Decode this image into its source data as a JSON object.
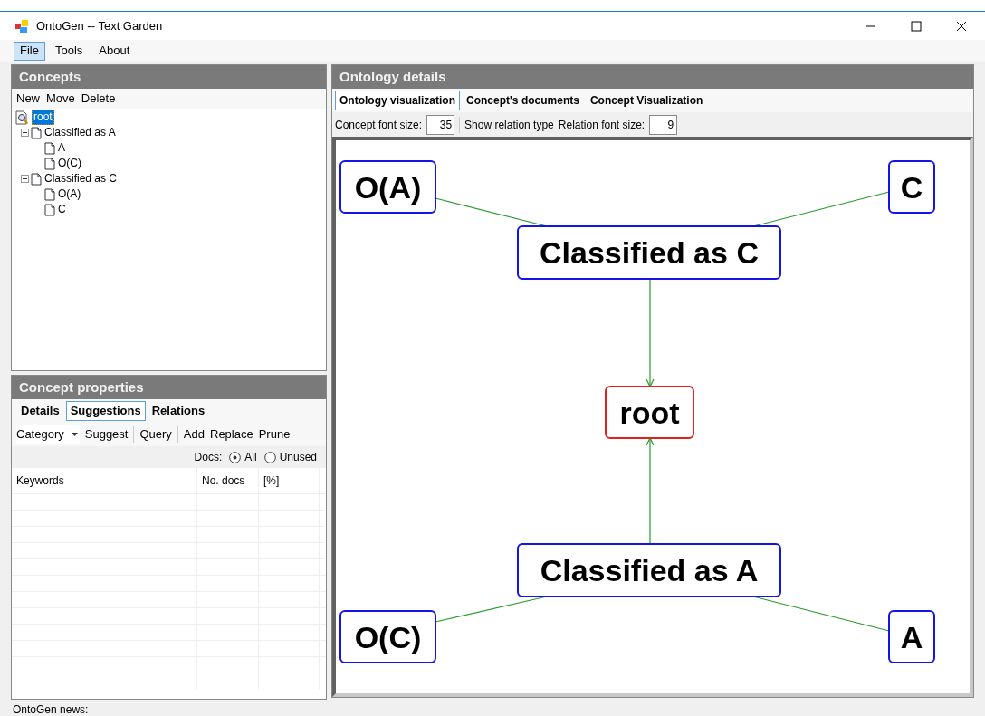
{
  "window": {
    "title": "OntoGen -- Text Garden"
  },
  "menu": [
    {
      "label": "File",
      "selected": true
    },
    {
      "label": "Tools",
      "selected": false
    },
    {
      "label": "About",
      "selected": false
    }
  ],
  "concepts": {
    "title": "Concepts",
    "toolbar": [
      "New",
      "Move",
      "Delete"
    ],
    "tree": [
      {
        "label": "root",
        "selected": true,
        "children": [
          {
            "label": "Classified as A",
            "selected": false,
            "expanded": true,
            "children": [
              {
                "label": "A",
                "selected": false
              },
              {
                "label": "O(C)",
                "selected": false
              }
            ]
          },
          {
            "label": "Classified as C",
            "selected": false,
            "expanded": true,
            "children": [
              {
                "label": "O(A)",
                "selected": false
              },
              {
                "label": "C",
                "selected": false
              }
            ]
          }
        ]
      }
    ]
  },
  "properties": {
    "title": "Concept properties",
    "tabs": [
      {
        "label": "Details",
        "selected": false
      },
      {
        "label": "Suggestions",
        "selected": true
      },
      {
        "label": "Relations",
        "selected": false
      }
    ],
    "toolbar": [
      {
        "kind": "dropdown",
        "label": "Category"
      },
      {
        "kind": "button",
        "label": "Suggest"
      },
      {
        "kind": "separator"
      },
      {
        "kind": "button",
        "label": "Query"
      },
      {
        "kind": "separator"
      },
      {
        "kind": "button",
        "label": "Add"
      },
      {
        "kind": "button",
        "label": "Replace"
      },
      {
        "kind": "button",
        "label": "Prune"
      }
    ],
    "docs_label": "Docs:",
    "docs_options": [
      {
        "label": "All",
        "selected": true
      },
      {
        "label": "Unused",
        "selected": false
      }
    ],
    "table": {
      "columns": [
        "Keywords",
        "No. docs",
        "[%]"
      ]
    }
  },
  "details": {
    "title": "Ontology details",
    "tabs": [
      {
        "label": "Ontology visualization",
        "selected": true
      },
      {
        "label": "Concept's documents",
        "selected": false
      },
      {
        "label": "Concept Visualization",
        "selected": false
      }
    ],
    "concept_font_label": "Concept font size:",
    "concept_font_value": "35",
    "show_relation": "Show relation type",
    "relation_font_label": "Relation font size:",
    "relation_font_value": "9",
    "graph": {
      "nodes": [
        {
          "label": "O(A)",
          "kind": "concept"
        },
        {
          "label": "C",
          "kind": "concept"
        },
        {
          "label": "Classified as C",
          "kind": "concept"
        },
        {
          "label": "root",
          "kind": "root"
        },
        {
          "label": "Classified as A",
          "kind": "concept"
        },
        {
          "label": "O(C)",
          "kind": "concept"
        },
        {
          "label": "A",
          "kind": "concept"
        }
      ]
    }
  },
  "status_bar": "OntoGen news:"
}
